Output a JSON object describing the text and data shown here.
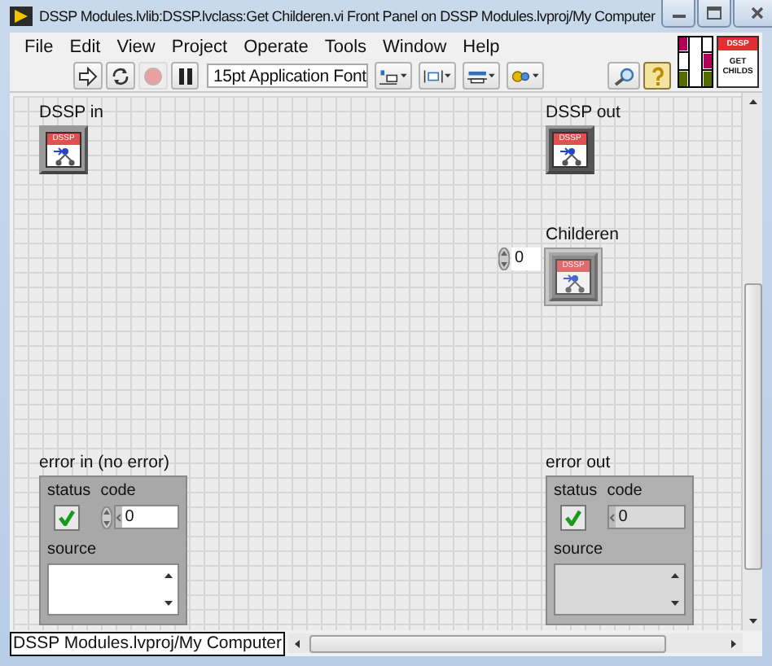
{
  "window": {
    "title": "DSSP Modules.lvlib:DSSP.lvclass:Get Childeren.vi Front Panel on DSSP Modules.lvproj/My Computer"
  },
  "menu": [
    "File",
    "Edit",
    "View",
    "Project",
    "Operate",
    "Tools",
    "Window",
    "Help"
  ],
  "toolbar": {
    "font": "15pt Application Font",
    "help_on": true
  },
  "vi_icon": {
    "banner": "DSSP",
    "caption": "GET CHILDS"
  },
  "controls": [
    {
      "kind": "class",
      "label": "DSSP in",
      "icon_text": "DSSP",
      "indicator": false
    },
    {
      "kind": "class",
      "label": "DSSP out",
      "icon_text": "DSSP",
      "indicator": true
    },
    {
      "kind": "class_array",
      "label": "Childeren",
      "index": "0",
      "icon_text": "DSSP",
      "indicator": true
    },
    {
      "kind": "error_cluster",
      "label": "error in (no error)",
      "status_label": "status",
      "status": false,
      "code_label": "code",
      "code": "0",
      "source_label": "source",
      "indicator": false
    },
    {
      "kind": "error_cluster",
      "label": "error out",
      "status_label": "status",
      "status": false,
      "code_label": "code",
      "code": "0",
      "source_label": "source",
      "indicator": true
    }
  ],
  "status_bar": "DSSP Modules.lvproj/My Computer"
}
